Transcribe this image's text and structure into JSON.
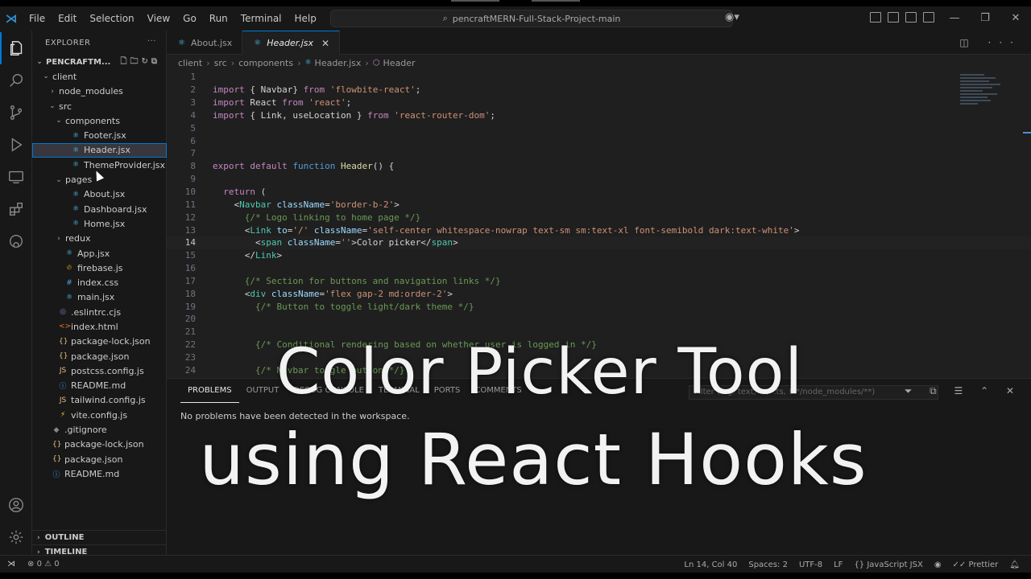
{
  "window": {
    "title": "pencraftMERN-Full-Stack-Project-main",
    "menu": [
      "File",
      "Edit",
      "Selection",
      "View",
      "Go",
      "Run",
      "Terminal",
      "Help"
    ]
  },
  "sidebar": {
    "header": "EXPLORER",
    "root": "PENCRAFTM...",
    "tree": [
      {
        "label": "client",
        "depth": 1,
        "kind": "folder-open"
      },
      {
        "label": "node_modules",
        "depth": 2,
        "kind": "folder"
      },
      {
        "label": "src",
        "depth": 2,
        "kind": "folder-open"
      },
      {
        "label": "components",
        "depth": 3,
        "kind": "folder-open"
      },
      {
        "label": "Footer.jsx",
        "depth": 4,
        "kind": "react"
      },
      {
        "label": "Header.jsx",
        "depth": 4,
        "kind": "react",
        "selected": true
      },
      {
        "label": "ThemeProvider.jsx",
        "depth": 4,
        "kind": "react"
      },
      {
        "label": "pages",
        "depth": 3,
        "kind": "folder-open"
      },
      {
        "label": "About.jsx",
        "depth": 4,
        "kind": "react"
      },
      {
        "label": "Dashboard.jsx",
        "depth": 4,
        "kind": "react"
      },
      {
        "label": "Home.jsx",
        "depth": 4,
        "kind": "react"
      },
      {
        "label": "redux",
        "depth": 3,
        "kind": "folder"
      },
      {
        "label": "App.jsx",
        "depth": 3,
        "kind": "react"
      },
      {
        "label": "firebase.js",
        "depth": 3,
        "kind": "fb"
      },
      {
        "label": "index.css",
        "depth": 3,
        "kind": "css"
      },
      {
        "label": "main.jsx",
        "depth": 3,
        "kind": "react"
      },
      {
        "label": ".eslintrc.cjs",
        "depth": 2,
        "kind": "eslint"
      },
      {
        "label": "index.html",
        "depth": 2,
        "kind": "html"
      },
      {
        "label": "package-lock.json",
        "depth": 2,
        "kind": "json"
      },
      {
        "label": "package.json",
        "depth": 2,
        "kind": "json"
      },
      {
        "label": "postcss.config.js",
        "depth": 2,
        "kind": "js"
      },
      {
        "label": "README.md",
        "depth": 2,
        "kind": "md"
      },
      {
        "label": "tailwind.config.js",
        "depth": 2,
        "kind": "js"
      },
      {
        "label": "vite.config.js",
        "depth": 2,
        "kind": "vite"
      },
      {
        "label": ".gitignore",
        "depth": 1,
        "kind": "git"
      },
      {
        "label": "package-lock.json",
        "depth": 1,
        "kind": "json"
      },
      {
        "label": "package.json",
        "depth": 1,
        "kind": "json"
      },
      {
        "label": "README.md",
        "depth": 1,
        "kind": "md"
      }
    ],
    "outline": "OUTLINE",
    "timeline": "TIMELINE"
  },
  "tabs": [
    {
      "label": "About.jsx",
      "active": false
    },
    {
      "label": "Header.jsx",
      "active": true
    }
  ],
  "breadcrumb": [
    "client",
    "src",
    "components",
    "Header.jsx",
    "Header"
  ],
  "code": {
    "current_line": 14,
    "lines": [
      "",
      "import { Navbar} from 'flowbite-react';",
      "import React from 'react';",
      "import { Link, useLocation } from 'react-router-dom';",
      "",
      "",
      "",
      "export default function Header() {",
      "",
      "  return (",
      "    <Navbar className='border-b-2'>",
      "      {/* Logo linking to home page */}",
      "      <Link to='/' className='self-center whitespace-nowrap text-sm sm:text-xl font-semibold dark:text-white'>",
      "        <span className=''>Color picker</span>",
      "      </Link>",
      "",
      "      {/* Section for buttons and navigation links */}",
      "      <div className='flex gap-2 md:order-2'>",
      "        {/* Button to toggle light/dark theme */}",
      "",
      "",
      "        {/* Conditional rendering based on whether user is logged in */}",
      "",
      "        {/* Navbar toggle button */}"
    ]
  },
  "panel": {
    "tabs": [
      "PROBLEMS",
      "OUTPUT",
      "DEBUG CONSOLE",
      "TERMINAL",
      "PORTS",
      "COMMENTS"
    ],
    "filter_placeholder": "Filter (e.g. text, **/*.ts, !**/node_modules/**)",
    "message": "No problems have been detected in the workspace."
  },
  "status": {
    "errors": "0",
    "warnings": "0",
    "position": "Ln 14, Col 40",
    "spaces": "Spaces: 2",
    "encoding": "UTF-8",
    "eol": "LF",
    "language": "JavaScript JSX",
    "formatter": "Prettier"
  },
  "overlay": {
    "line1": "Color Picker Tool",
    "line2": "using React Hooks"
  }
}
